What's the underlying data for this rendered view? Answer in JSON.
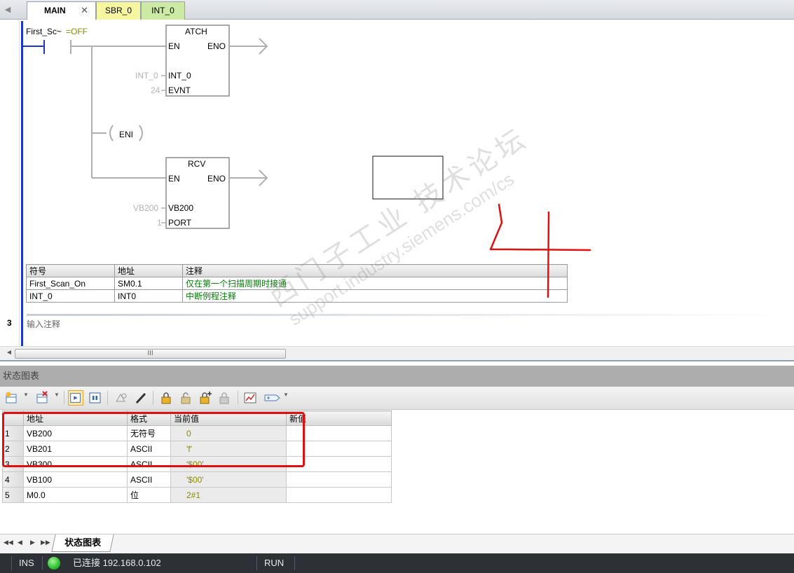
{
  "tabs": {
    "main": {
      "label": "MAIN",
      "close": "✕"
    },
    "sbr": {
      "label": "SBR_0"
    },
    "int": {
      "label": "INT_0"
    }
  },
  "ladder": {
    "contact_label": "First_Sc~",
    "contact_state": "=OFF",
    "atch": {
      "title": "ATCH",
      "en": "EN",
      "eno": "ENO",
      "in1_value": "INT_0",
      "in1_pin": "INT_0",
      "in2_value": "24",
      "in2_pin": "EVNT"
    },
    "eni": {
      "label": "ENI"
    },
    "rcv": {
      "title": "RCV",
      "en": "EN",
      "eno": "ENO",
      "in1_value": "VB200",
      "in1_pin": "VB200",
      "in2_value": "1",
      "in2_pin": "PORT"
    },
    "symbol_table": {
      "headers": [
        "符号",
        "地址",
        "注释"
      ],
      "rows": [
        {
          "symbol": "First_Scan_On",
          "address": "SM0.1",
          "comment": "仅在第一个扫描周期时接通"
        },
        {
          "symbol": "INT_0",
          "address": "INT0",
          "comment": "中断例程注释"
        }
      ]
    },
    "network3": {
      "number": "3",
      "comment": "输入注释"
    }
  },
  "hscroll": {
    "thumb_grip": "III",
    "left_arrow": "◄"
  },
  "status_chart": {
    "panel_title": "状态图表",
    "columns": [
      "地址",
      "格式",
      "当前值",
      "新值"
    ],
    "rows": [
      {
        "num": "1",
        "address": "VB200",
        "format": "无符号",
        "current": "0",
        "new": ""
      },
      {
        "num": "2",
        "address": "VB201",
        "format": "ASCII",
        "current": "'f'",
        "new": ""
      },
      {
        "num": "3",
        "address": "VB300",
        "format": "ASCII",
        "current": "'$00'",
        "new": ""
      },
      {
        "num": "4",
        "address": "VB100",
        "format": "ASCII",
        "current": "'$00'",
        "new": ""
      },
      {
        "num": "5",
        "address": "M0.0",
        "format": "位",
        "current": "2#1",
        "new": ""
      }
    ],
    "sheet_tab": "状态图表",
    "nav": [
      "◀◀",
      "◀",
      "▶",
      "▶▶"
    ]
  },
  "statusbar": {
    "mode": "INS",
    "connection": "已连接 192.168.0.102",
    "run_state": "RUN"
  },
  "watermark": {
    "line1": "西门子工业  技术论坛",
    "line2": "support.industry.siemens.com/cs"
  },
  "colors": {
    "rail": "#1c36c8",
    "state_text": "#8a8a00",
    "comment_green": "#008000",
    "annotation_red": "#e01010",
    "status_ok": "#2fbf2f"
  }
}
